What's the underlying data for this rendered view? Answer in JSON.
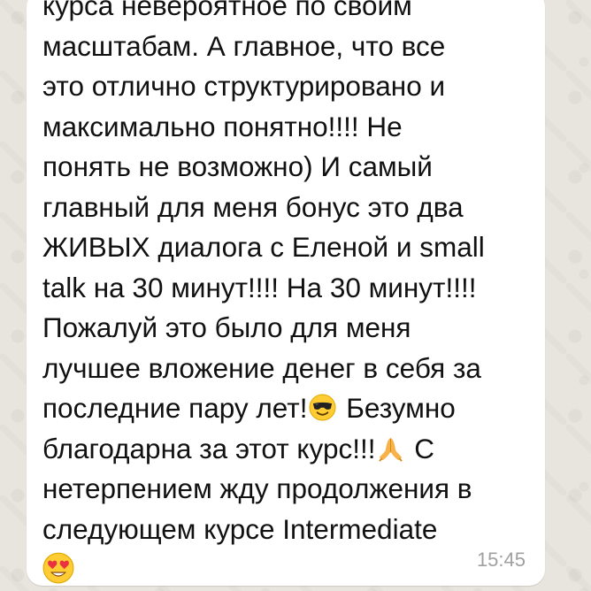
{
  "message": {
    "lines": [
      {
        "text": "курса невероятное по своим"
      },
      {
        "text": "масштабам. А главное, что все"
      },
      {
        "text": "это отлично структурировано и"
      },
      {
        "text": "максимально понятно!!!! Не"
      },
      {
        "text": "понять не возможно) И самый"
      },
      {
        "text": "главный для меня бонус это два"
      },
      {
        "text": "ЖИВЫХ диалога с Еленой и small"
      },
      {
        "text": "talk на 30 минут!!!! На 30 минут!!!!"
      },
      {
        "text": "Пожалуй это было для меня"
      },
      {
        "text": "лучшее вложение денег в себя за"
      },
      {
        "before": "последние пару лет!",
        "after": " Безумно",
        "emoji": "smiling-face-with-sunglasses"
      },
      {
        "before": "благодарна за этот курс!!!",
        "after": " С",
        "emoji": "folded-hands"
      },
      {
        "text": "нетерпением жду продолжения в"
      },
      {
        "text": "следующем курсе Intermediate"
      },
      {
        "emoji": "smiling-face-with-heart-eyes"
      }
    ],
    "time": "15:45"
  }
}
